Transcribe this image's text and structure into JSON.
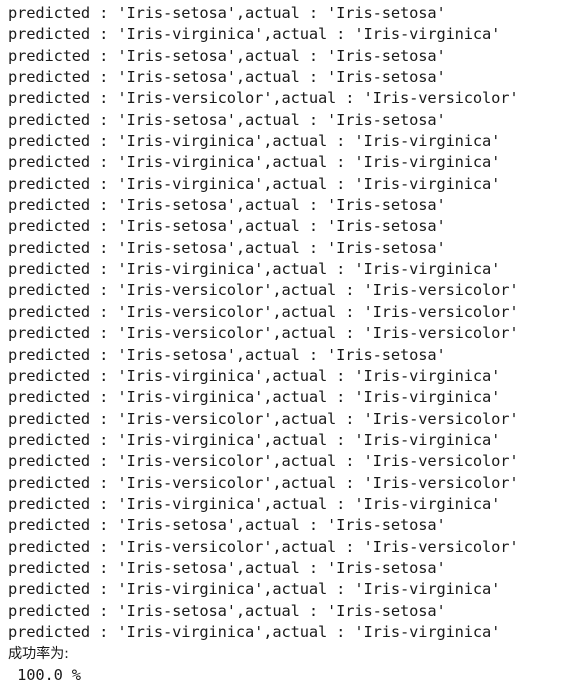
{
  "console": {
    "line_prefix": "predicted : ",
    "separator": ",actual : ",
    "quote": "'",
    "text_color": "#1a1a1a",
    "background_color": "#ffffff",
    "rows": [
      {
        "index": 1,
        "predicted": "Iris-setosa",
        "actual": "Iris-setosa",
        "text": "predicted : 'Iris-setosa',actual : 'Iris-setosa'"
      },
      {
        "index": 2,
        "predicted": "Iris-virginica",
        "actual": "Iris-virginica",
        "text": "predicted : 'Iris-virginica',actual : 'Iris-virginica'"
      },
      {
        "index": 3,
        "predicted": "Iris-setosa",
        "actual": "Iris-setosa",
        "text": "predicted : 'Iris-setosa',actual : 'Iris-setosa'"
      },
      {
        "index": 4,
        "predicted": "Iris-setosa",
        "actual": "Iris-setosa",
        "text": "predicted : 'Iris-setosa',actual : 'Iris-setosa'"
      },
      {
        "index": 5,
        "predicted": "Iris-versicolor",
        "actual": "Iris-versicolor",
        "text": "predicted : 'Iris-versicolor',actual : 'Iris-versicolor'"
      },
      {
        "index": 6,
        "predicted": "Iris-setosa",
        "actual": "Iris-setosa",
        "text": "predicted : 'Iris-setosa',actual : 'Iris-setosa'"
      },
      {
        "index": 7,
        "predicted": "Iris-virginica",
        "actual": "Iris-virginica",
        "text": "predicted : 'Iris-virginica',actual : 'Iris-virginica'"
      },
      {
        "index": 8,
        "predicted": "Iris-virginica",
        "actual": "Iris-virginica",
        "text": "predicted : 'Iris-virginica',actual : 'Iris-virginica'"
      },
      {
        "index": 9,
        "predicted": "Iris-virginica",
        "actual": "Iris-virginica",
        "text": "predicted : 'Iris-virginica',actual : 'Iris-virginica'"
      },
      {
        "index": 10,
        "predicted": "Iris-setosa",
        "actual": "Iris-setosa",
        "text": "predicted : 'Iris-setosa',actual : 'Iris-setosa'"
      },
      {
        "index": 11,
        "predicted": "Iris-setosa",
        "actual": "Iris-setosa",
        "text": "predicted : 'Iris-setosa',actual : 'Iris-setosa'"
      },
      {
        "index": 12,
        "predicted": "Iris-setosa",
        "actual": "Iris-setosa",
        "text": "predicted : 'Iris-setosa',actual : 'Iris-setosa'"
      },
      {
        "index": 13,
        "predicted": "Iris-virginica",
        "actual": "Iris-virginica",
        "text": "predicted : 'Iris-virginica',actual : 'Iris-virginica'"
      },
      {
        "index": 14,
        "predicted": "Iris-versicolor",
        "actual": "Iris-versicolor",
        "text": "predicted : 'Iris-versicolor',actual : 'Iris-versicolor'"
      },
      {
        "index": 15,
        "predicted": "Iris-versicolor",
        "actual": "Iris-versicolor",
        "text": "predicted : 'Iris-versicolor',actual : 'Iris-versicolor'"
      },
      {
        "index": 16,
        "predicted": "Iris-versicolor",
        "actual": "Iris-versicolor",
        "text": "predicted : 'Iris-versicolor',actual : 'Iris-versicolor'"
      },
      {
        "index": 17,
        "predicted": "Iris-setosa",
        "actual": "Iris-setosa",
        "text": "predicted : 'Iris-setosa',actual : 'Iris-setosa'"
      },
      {
        "index": 18,
        "predicted": "Iris-virginica",
        "actual": "Iris-virginica",
        "text": "predicted : 'Iris-virginica',actual : 'Iris-virginica'"
      },
      {
        "index": 19,
        "predicted": "Iris-virginica",
        "actual": "Iris-virginica",
        "text": "predicted : 'Iris-virginica',actual : 'Iris-virginica'"
      },
      {
        "index": 20,
        "predicted": "Iris-versicolor",
        "actual": "Iris-versicolor",
        "text": "predicted : 'Iris-versicolor',actual : 'Iris-versicolor'"
      },
      {
        "index": 21,
        "predicted": "Iris-virginica",
        "actual": "Iris-virginica",
        "text": "predicted : 'Iris-virginica',actual : 'Iris-virginica'"
      },
      {
        "index": 22,
        "predicted": "Iris-versicolor",
        "actual": "Iris-versicolor",
        "text": "predicted : 'Iris-versicolor',actual : 'Iris-versicolor'"
      },
      {
        "index": 23,
        "predicted": "Iris-versicolor",
        "actual": "Iris-versicolor",
        "text": "predicted : 'Iris-versicolor',actual : 'Iris-versicolor'"
      },
      {
        "index": 24,
        "predicted": "Iris-virginica",
        "actual": "Iris-virginica",
        "text": "predicted : 'Iris-virginica',actual : 'Iris-virginica'"
      },
      {
        "index": 25,
        "predicted": "Iris-setosa",
        "actual": "Iris-setosa",
        "text": "predicted : 'Iris-setosa',actual : 'Iris-setosa'"
      },
      {
        "index": 26,
        "predicted": "Iris-versicolor",
        "actual": "Iris-versicolor",
        "text": "predicted : 'Iris-versicolor',actual : 'Iris-versicolor'"
      },
      {
        "index": 27,
        "predicted": "Iris-setosa",
        "actual": "Iris-setosa",
        "text": "predicted : 'Iris-setosa',actual : 'Iris-setosa'"
      },
      {
        "index": 28,
        "predicted": "Iris-virginica",
        "actual": "Iris-virginica",
        "text": "predicted : 'Iris-virginica',actual : 'Iris-virginica'"
      },
      {
        "index": 29,
        "predicted": "Iris-setosa",
        "actual": "Iris-setosa",
        "text": "predicted : 'Iris-setosa',actual : 'Iris-setosa'"
      },
      {
        "index": 30,
        "predicted": "Iris-virginica",
        "actual": "Iris-virginica",
        "text": "predicted : 'Iris-virginica',actual : 'Iris-virginica'"
      }
    ]
  },
  "summary": {
    "label": "成功率为:",
    "value": " 100.0 %"
  }
}
